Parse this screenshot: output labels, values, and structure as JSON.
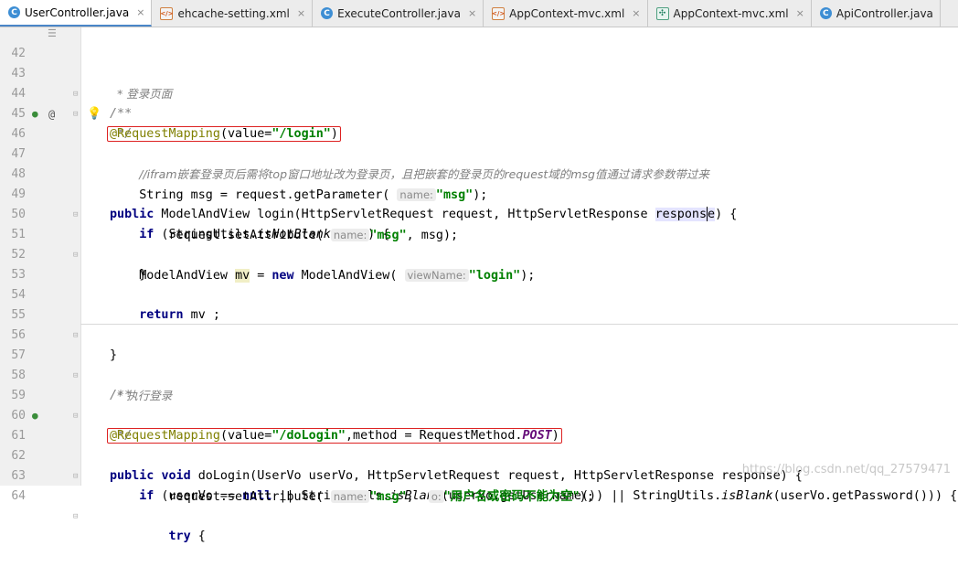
{
  "tabs": [
    {
      "label": "UserController.java",
      "icon": "java-class-icon",
      "active": true
    },
    {
      "label": "ehcache-setting.xml",
      "icon": "xml-file-icon",
      "active": false
    },
    {
      "label": "ExecuteController.java",
      "icon": "java-class-icon",
      "active": false
    },
    {
      "label": "AppContext-mvc.xml",
      "icon": "xml-file-icon",
      "active": false
    },
    {
      "label": "AppContext-mvc.xml",
      "icon": "spring-xml-icon",
      "active": false
    },
    {
      "label": "ApiController.java",
      "icon": "java-class-icon",
      "active": false
    }
  ],
  "close_glyph": "×",
  "lines": [
    {
      "n": "42",
      "c": "/**"
    },
    {
      "n": "43",
      "c": " * 登录页面"
    },
    {
      "n": "44",
      "c": " */"
    },
    {
      "n": "45",
      "c": "@RequestMapping(value=\"/login\")"
    },
    {
      "n": "46",
      "c": "public ModelAndView login(HttpServletRequest request, HttpServletResponse response) {"
    },
    {
      "n": "47",
      "c": "    //ifram嵌套登录页后需将top窗口地址改为登录页，且把嵌套的登录页的request域的msg值通过请求参数带过来"
    },
    {
      "n": "48",
      "c": "    String msg = request.getParameter( name: \"msg\");"
    },
    {
      "n": "49",
      "c": "    if (StringUtils.isNotBlank(msg)) {"
    },
    {
      "n": "50",
      "c": "        request.setAttribute( name: \"msg\", msg);"
    },
    {
      "n": "51",
      "c": "    }"
    },
    {
      "n": "52",
      "c": "    ModelAndView mv = new ModelAndView( viewName: \"login\");"
    },
    {
      "n": "53",
      "c": ""
    },
    {
      "n": "54",
      "c": "    return mv ;"
    },
    {
      "n": "55",
      "c": "}"
    },
    {
      "n": "56",
      "c": ""
    },
    {
      "n": "57",
      "c": "/**"
    },
    {
      "n": "58",
      "c": " * 执行登录"
    },
    {
      "n": "59",
      "c": " */"
    },
    {
      "n": "60",
      "c": "@RequestMapping(value=\"/doLogin\",method = RequestMethod.POST)"
    },
    {
      "n": "61",
      "c": "public void doLogin(UserVo userVo, HttpServletRequest request, HttpServletResponse response) {"
    },
    {
      "n": "62",
      "c": "    if (userVo == null || StringUtils.isBlank(userVo.getUsername()) || StringUtils.isBlank(userVo.getPassword())) {"
    },
    {
      "n": "63",
      "c": "        request.setAttribute( name: \"msg\",  o: \"用户名或密码不能为空\");"
    },
    {
      "n": "64",
      "c": "        try {"
    }
  ],
  "parts": {
    "l43": "* 登录页面",
    "l47": "//ifram嵌套登录页后需将top窗口地址改为登录页，且把嵌套的登录页的request域的msg值通过请求参数带过来",
    "l58": "* 执行登录",
    "l63_str": "\"用户名或密码不能为空\"",
    "l45_ann": "@RequestMapping",
    "l45_str": "\"/login\"",
    "l60_str": "\"/doLogin\"",
    "hint_name": "name:",
    "hint_viewName": "viewName:",
    "hint_o": "o:"
  },
  "watermark": "https://blog.csdn.net/qq_27579471",
  "colors": {
    "keyword": "#000080",
    "string": "#008000",
    "annotation": "#808000",
    "comment": "#808080",
    "highlight_box": "#d22222"
  }
}
